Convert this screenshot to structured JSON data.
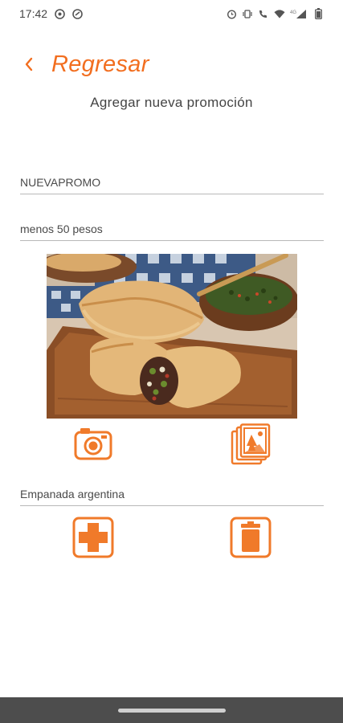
{
  "status_bar": {
    "time": "17:42",
    "left_icons": [
      "whatsapp-icon",
      "notification-icon"
    ],
    "right_icons": [
      "alarm-icon",
      "vibrate-icon",
      "volte-call-icon",
      "wifi-icon",
      "signal-4g-icon",
      "battery-icon"
    ],
    "network_label": "4G"
  },
  "header": {
    "back_label": "Regresar",
    "accent_color": "#f26e1f"
  },
  "page": {
    "subtitle": "Agregar nueva promoción"
  },
  "form": {
    "promo_code": "NUEVAPROMO",
    "promo_description": "menos 50 pesos",
    "photo_caption": "Empanada argentina"
  },
  "actions": {
    "camera": "camera-icon",
    "gallery": "gallery-icon",
    "add": "add-icon",
    "delete": "trash-icon"
  }
}
